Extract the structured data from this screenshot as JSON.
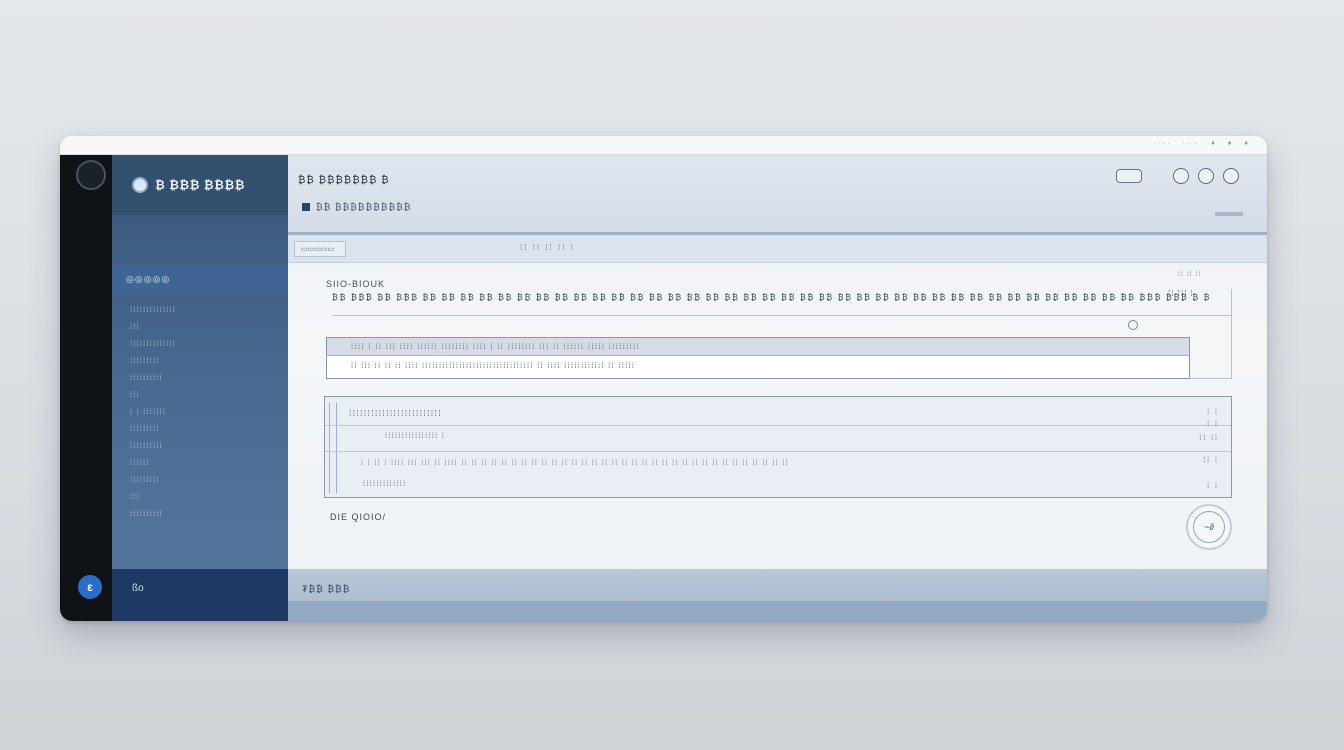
{
  "topbar": {
    "sys_items": [
      "·····",
      "·····",
      "♦",
      "♦",
      "♦"
    ]
  },
  "sidebar": {
    "brand": "₿ ₿₿₿ ₿₿₿₿",
    "active_item": "◎◎◎◎◎",
    "items": [
      "⁞⁞⁞⁞⁞⁞⁞⁞⁞⁞⁞⁞⁞⁞",
      "⁞⁞⁞",
      "⁞⁞⁞⁞⁞⁞⁞⁞⁞⁞⁞⁞⁞⁞",
      "⁞⁞⁞⁞⁞⁞⁞⁞⁞",
      "⁞⁞⁞⁞⁞⁞⁞⁞⁞⁞",
      "⁞⁞⁞",
      "⁞ ⁞ ⁞⁞⁞⁞⁞⁞⁞",
      "⁞⁞⁞⁞⁞⁞⁞⁞⁞",
      "⁞⁞⁞⁞⁞⁞⁞⁞⁞⁞",
      "⁞⁞⁞⁞⁞⁞",
      "⁞⁞⁞⁞⁞⁞⁞⁞⁞",
      "⁞⁞⁞",
      "⁞⁞⁞⁞⁞⁞⁞⁞⁞⁞"
    ],
    "footer_label": "ßo"
  },
  "help_icon": "ε",
  "header": {
    "title": "₿₿ ₿₿₿₿₿₿₿ ₿",
    "subtitle": "₿₿ ₿₿₿₿₿₿₿₿₿₿"
  },
  "breadbar": {
    "chip": "▭▭▭▭▭",
    "crumbs": "⁞⁞ ⁞⁞ ⁞⁞ ⁞⁞ ⁞"
  },
  "section": {
    "title": "SIIO-BIOUK",
    "description": "₿₿ ₿₿₿ ₿₿ ₿₿₿ ₿₿ ₿₿ ₿₿ ₿₿ ₿₿ ₿₿ ₿₿ ₿₿ ₿₿ ₿₿ ₿₿ ₿₿ ₿₿ ₿₿ ₿₿ ₿₿ ₿₿ ₿₿ ₿₿ ₿₿ ₿₿ ₿₿ ₿₿ ₿₿ ₿₿ ₿₿ ₿₿ ₿₿ ₿₿ ₿₿ ₿₿ ₿₿ ₿₿ ₿₿ ₿₿ ₿₿ ₿₿ ₿₿ ₿₿₿ ₿₿₿ ₿ ₿",
    "right_hint": "⁞⁞ ⁞⁞ ⁞⁞",
    "right_value": "⁞⁞ ⁞⁞⁞ ⁞"
  },
  "info_box": {
    "row1": "⁞⁞⁞⁞ ⁞ ⁞⁞ ⁞⁞⁞ ⁞⁞⁞⁞ ⁞⁞⁞⁞⁞⁞ ⁞⁞⁞⁞⁞⁞⁞⁞ ⁞⁞⁞⁞ ⁞ ⁞⁞ ⁞⁞⁞⁞⁞⁞⁞⁞ ⁞⁞⁞ ⁞⁞ ⁞⁞⁞⁞⁞⁞ ⁞⁞⁞⁞⁞ ⁞⁞⁞⁞⁞⁞⁞⁞⁞",
    "row2": "⁞⁞ ⁞⁞⁞ ⁞⁞ ⁞⁞ ⁞⁞ ⁞⁞⁞⁞ ⁞⁞⁞⁞⁞⁞⁞⁞⁞⁞⁞⁞⁞⁞⁞⁞⁞⁞⁞⁞⁞⁞⁞⁞⁞⁞⁞⁞⁞⁞⁞⁞⁞ ⁞⁞ ⁞⁞⁞⁞ ⁞⁞⁞⁞⁞⁞⁞⁞⁞⁞⁞⁞ ⁞⁞ ⁞⁞⁞⁞⁞"
  },
  "table": {
    "header": "⁞⁞⁞⁞⁞⁞⁞⁞⁞⁞⁞⁞⁞⁞⁞⁞⁞⁞⁞⁞⁞⁞⁞⁞⁞",
    "row1": "⁞⁞⁞⁞⁞⁞⁞⁞⁞⁞⁞⁞⁞⁞⁞⁞ ⁞",
    "row2": "⁞ ⁞ ⁞⁞ ⁞ ⁞⁞⁞⁞ ⁞⁞⁞ ⁞⁞⁞ ⁞⁞ ⁞⁞⁞⁞ ⁞⁞ ⁞⁞ ⁞⁞ ⁞⁞ ⁞⁞ ⁞⁞ ⁞⁞ ⁞⁞ ⁞⁞ ⁞⁞ ⁞⁞ ⁞⁞ ⁞⁞ ⁞⁞ ⁞⁞ ⁞⁞ ⁞⁞ ⁞⁞ ⁞⁞ ⁞⁞ ⁞⁞ ⁞⁞ ⁞⁞ ⁞⁞ ⁞⁞ ⁞⁞ ⁞⁞ ⁞⁞ ⁞⁞ ⁞⁞ ⁞⁞ ⁞⁞ ⁞⁞",
    "row3": "⁞⁞⁞⁞⁞⁞⁞⁞⁞⁞⁞⁞⁞",
    "right_col": [
      "⁞ ⁞",
      "⁞ ⁞",
      "⁞⁞ ⁞⁞",
      "⁞⁞ ⁞",
      "⁞ ⁞"
    ]
  },
  "footnote": "DIE QIOIO/",
  "badge": "~∂",
  "statusbar": {
    "label": "₮₿₿ ₿₿₿"
  },
  "colors": {
    "sidebar": "#4a6a92",
    "accent": "#2d6cc9",
    "footer": "#1e3a64"
  }
}
